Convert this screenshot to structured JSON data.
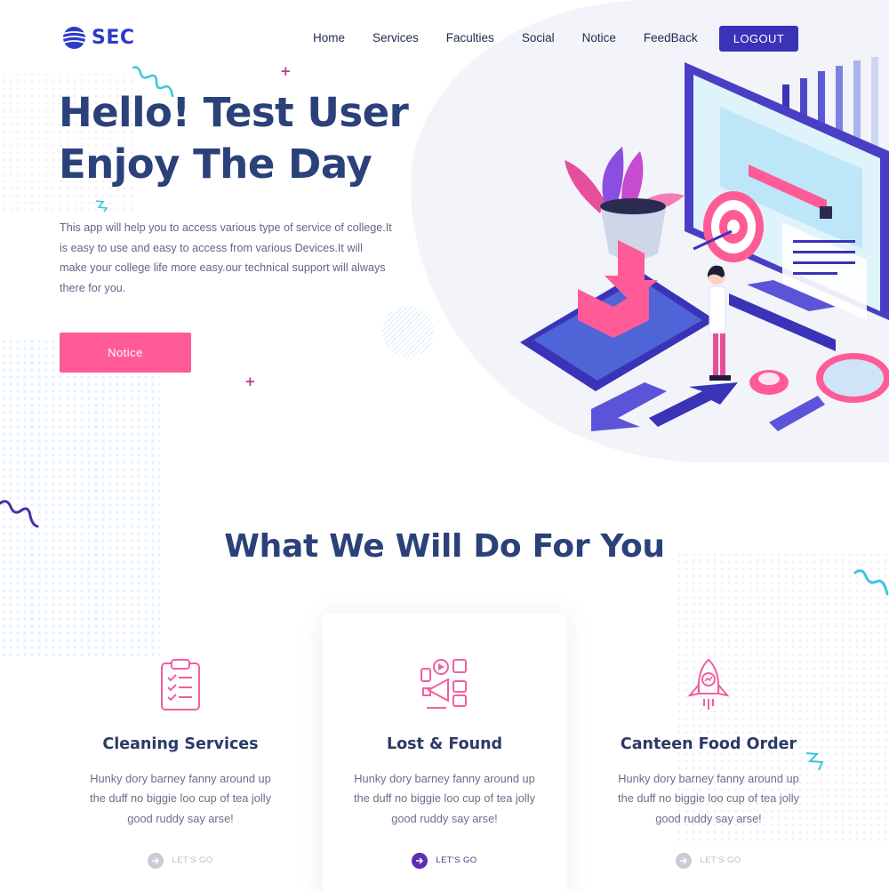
{
  "brand": {
    "name": "SEC",
    "logo_icon": "globe-stripes-icon",
    "color": "#2b3ac8"
  },
  "nav": {
    "items": [
      {
        "label": "Home"
      },
      {
        "label": "Services"
      },
      {
        "label": "Faculties"
      },
      {
        "label": "Social"
      },
      {
        "label": "Notice"
      },
      {
        "label": "FeedBack"
      }
    ],
    "logout_label": "LOGOUT"
  },
  "hero": {
    "title_line1": "Hello! Test User",
    "title_line2": "Enjoy The Day",
    "description": "This app will help you to access various type of service of college.It is easy to use and easy to access from various Devices.It will make your college life more easy.our technical support will always there for you.",
    "cta_label": "Notice"
  },
  "services": {
    "title": "What We Will Do For You",
    "cards": [
      {
        "icon": "clipboard-checklist-icon",
        "title": "Cleaning Services",
        "description": "Hunky dory barney fanny around up the duff no biggie loo cup of tea jolly good ruddy say arse!",
        "link_label": "LET'S GO"
      },
      {
        "icon": "megaphone-social-icon",
        "title": "Lost & Found",
        "description": "Hunky dory barney fanny around up the duff no biggie loo cup of tea jolly good ruddy say arse!",
        "link_label": "LET'S GO"
      },
      {
        "icon": "rocket-icon",
        "title": "Canteen Food Order",
        "description": "Hunky dory barney fanny around up the duff no biggie loo cup of tea jolly good ruddy say arse!",
        "link_label": "LET'S GO"
      }
    ]
  },
  "colors": {
    "primary": "#3a33b8",
    "accent_pink": "#ff5b97",
    "heading": "#2b4179",
    "link_active": "#5b2fb3"
  }
}
